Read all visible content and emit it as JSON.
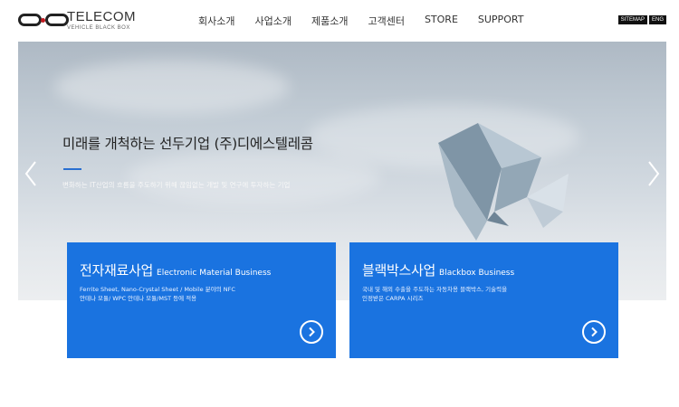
{
  "header": {
    "logo": {
      "title": "TELECOM",
      "subtitle": "VEHICLE BLACK BOX"
    },
    "nav": [
      {
        "label": "회사소개"
      },
      {
        "label": "사업소개"
      },
      {
        "label": "제품소개"
      },
      {
        "label": "고객센터"
      },
      {
        "label": "STORE"
      },
      {
        "label": "SUPPORT"
      }
    ],
    "util": {
      "sitemap": "SITEMAP",
      "lang": "ENG"
    }
  },
  "hero": {
    "title": "미래를 개척하는 선두기업 (주)디에스텔레콤",
    "subtitle": "변화하는 IT산업의 흐름을 주도하기 위해 끊임없는 개발 및 연구에 투자하는 기업",
    "prev_icon": "chevron-left-icon",
    "next_icon": "chevron-right-icon",
    "accent_color": "#2a6fd0"
  },
  "cards": [
    {
      "title_ko": "전자재료사업",
      "title_en": "Electronic Material Business",
      "desc_line1": "Ferrite Sheet, Nano-Crystal Sheet / Mobile 분야의 NFC",
      "desc_line2": "안테나 모듈/ WPC 안테나 모듈/MST 등에 적용",
      "icon": "chevron-right-circle-icon"
    },
    {
      "title_ko": "블랙박스사업",
      "title_en": "Blackbox Business",
      "desc_line1": "국내 및 해외 수출을 주도하는 자동차용 블랙박스, 기술력을",
      "desc_line2": "인정받은 CARPA 시리즈",
      "icon": "chevron-right-circle-icon"
    }
  ],
  "colors": {
    "card_blue": "#1a73e0",
    "util_black": "#111111"
  }
}
